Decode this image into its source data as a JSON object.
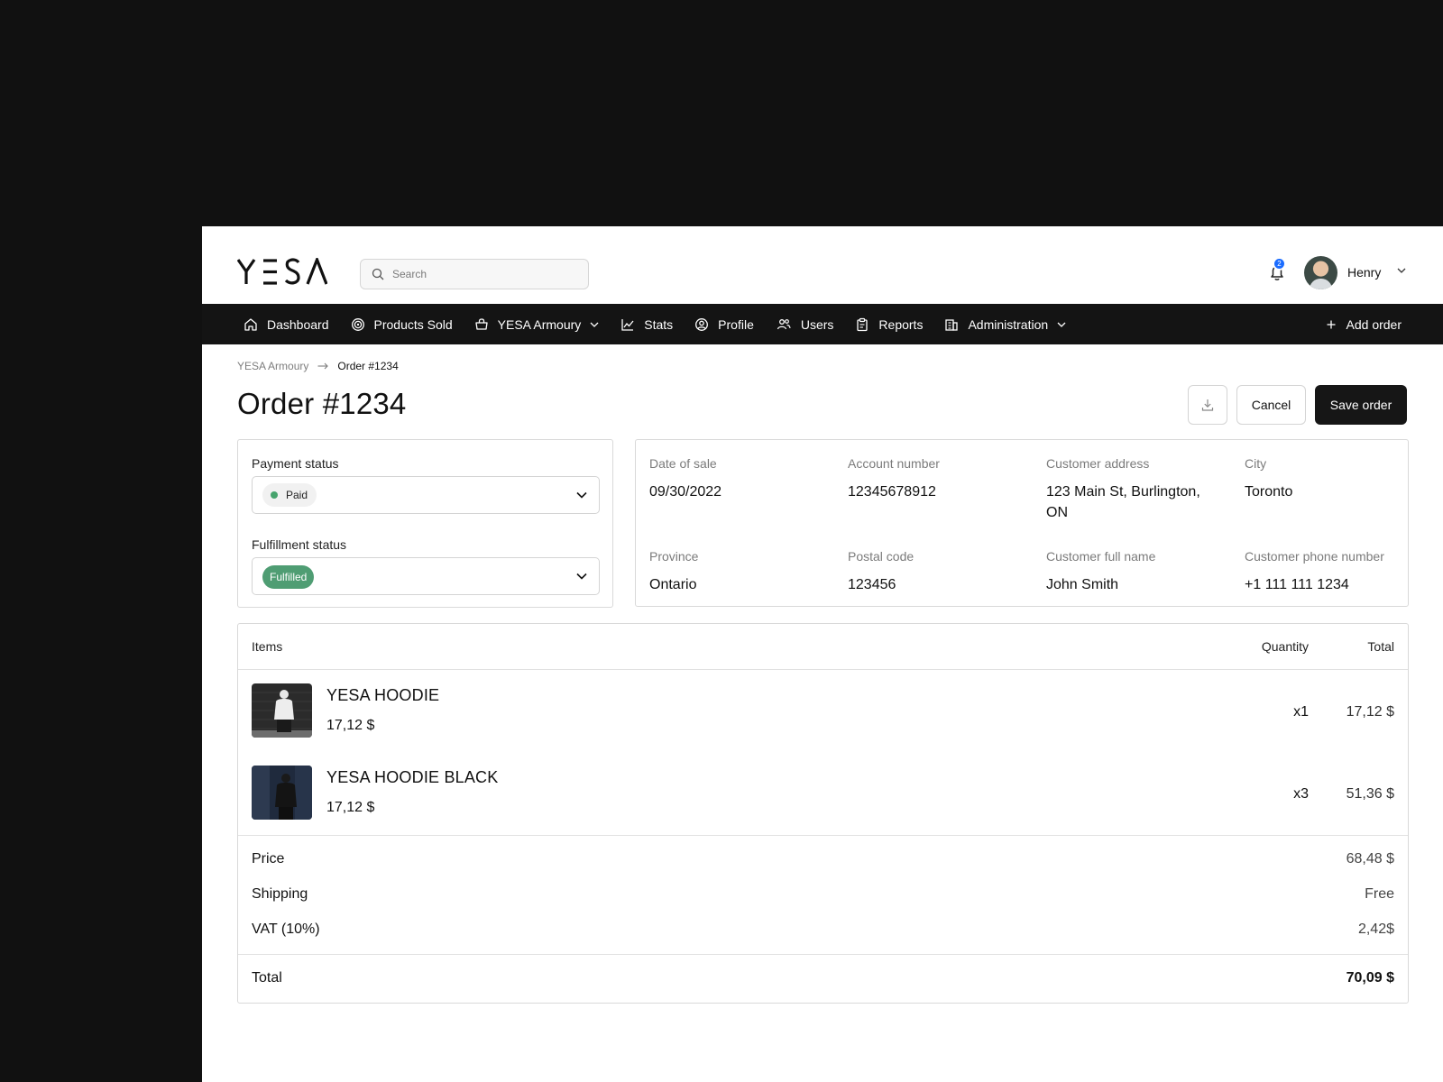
{
  "brand": {
    "logo_text": "YESA"
  },
  "search": {
    "placeholder": "Search",
    "value": ""
  },
  "notifications": {
    "count": "2"
  },
  "user": {
    "name": "Henry"
  },
  "nav": {
    "items": [
      {
        "label": "Dashboard",
        "icon": "home-icon"
      },
      {
        "label": "Products Sold",
        "icon": "target-icon"
      },
      {
        "label": "YESA Armoury",
        "icon": "basket-icon",
        "dropdown": true
      },
      {
        "label": "Stats",
        "icon": "chart-icon"
      },
      {
        "label": "Profile",
        "icon": "user-circle-icon"
      },
      {
        "label": "Users",
        "icon": "users-icon"
      },
      {
        "label": "Reports",
        "icon": "clipboard-icon"
      },
      {
        "label": "Administration",
        "icon": "building-icon",
        "dropdown": true
      }
    ],
    "add_order": "Add order"
  },
  "breadcrumb": {
    "parent": "YESA Armoury",
    "current": "Order #1234"
  },
  "page": {
    "title": "Order #1234",
    "cancel_label": "Cancel",
    "save_label": "Save order"
  },
  "status": {
    "payment_label": "Payment status",
    "payment_value": "Paid",
    "fulfillment_label": "Fulfillment status",
    "fulfillment_value": "Fulfilled"
  },
  "info": [
    {
      "label": "Date of sale",
      "value": "09/30/2022"
    },
    {
      "label": "Account number",
      "value": "12345678912"
    },
    {
      "label": "Customer address",
      "value": "123 Main St, Burlington, ON"
    },
    {
      "label": "City",
      "value": "Toronto"
    },
    {
      "label": "Province",
      "value": "Ontario"
    },
    {
      "label": "Postal code",
      "value": "123456"
    },
    {
      "label": "Customer full name",
      "value": "John Smith"
    },
    {
      "label": "Customer phone number",
      "value": "+1 111 111 1234"
    }
  ],
  "items": {
    "header": {
      "items": "Items",
      "quantity": "Quantity",
      "total": "Total"
    },
    "rows": [
      {
        "name": "YESA HOODIE",
        "price": "17,12 $",
        "quantity": "x1",
        "total": "17,12 $"
      },
      {
        "name": "YESA HOODIE BLACK",
        "price": "17,12 $",
        "quantity": "x3",
        "total": "51,36 $"
      }
    ]
  },
  "summary": {
    "price_label": "Price",
    "price_value": "68,48 $",
    "shipping_label": "Shipping",
    "shipping_value": "Free",
    "vat_label": "VAT (10%)",
    "vat_value": "2,42$",
    "total_label": "Total",
    "total_value": "70,09 $"
  },
  "colors": {
    "nav_bg": "#141414",
    "primary_button": "#161616",
    "fulfilled_badge": "#4f9d73",
    "paid_dot": "#46a36d",
    "notification_badge": "#1a6cff"
  }
}
